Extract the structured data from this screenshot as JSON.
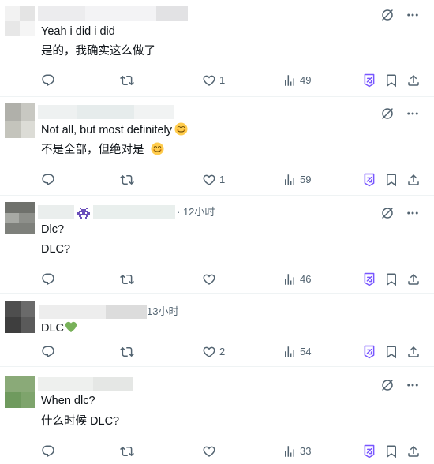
{
  "replies": [
    {
      "text1": "Yeah i did i did",
      "text2": "是的，我确实这么做了",
      "likes": "1",
      "views": "49"
    },
    {
      "text1": "Not all, but most definitely",
      "text2": "不是全部，但绝对是",
      "likes": "1",
      "views": "59"
    },
    {
      "time": "· 12小时",
      "text1": "Dlc?",
      "text2": "DLC?",
      "likes": "",
      "views": "46"
    },
    {
      "time": "13小时",
      "text1": "DLC",
      "likes": "2",
      "views": "54"
    },
    {
      "text1": "When dlc?",
      "text2": "什么时候 DLC?",
      "likes": "",
      "views": "33"
    }
  ],
  "colors": {
    "icon_gray": "#536471",
    "accent_purple": "#7856ff",
    "text_dark": "#0f1419",
    "heart_green": "#78b159",
    "emoji_yellow": "#ffcc4d"
  },
  "icons": [
    "reply-icon",
    "retweet-icon",
    "like-icon",
    "views-icon",
    "grok-icon",
    "bookmark-icon",
    "share-icon",
    "grok-explain-icon",
    "more-icon"
  ]
}
